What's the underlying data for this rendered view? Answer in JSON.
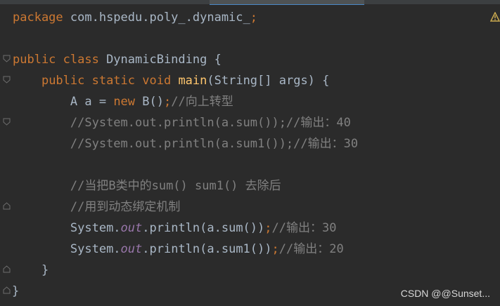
{
  "editor": {
    "lines": [
      {
        "parts": [
          "package",
          " com.hspedu.poly_.dynamic_",
          ";"
        ]
      },
      {
        "parts": [
          "public class",
          " DynamicBinding {"
        ]
      },
      {
        "parts": [
          "public static void",
          " ",
          "main",
          "(String[] args) {"
        ]
      },
      {
        "parts": [
          "A a = ",
          "new",
          " B()",
          ";",
          "//向上转型"
        ]
      },
      {
        "parts": [
          "//System.out.println(a.sum());//输出：40"
        ]
      },
      {
        "parts": [
          "//System.out.println(a.sum1());//输出：30"
        ]
      },
      {
        "parts": [
          "//当把B类中的sum() sum1() 去除后"
        ]
      },
      {
        "parts": [
          "//用到动态绑定机制"
        ]
      },
      {
        "parts": [
          "System.",
          "out",
          ".println(a.sum())",
          ";",
          "//输出：30"
        ]
      },
      {
        "parts": [
          "System.",
          "out",
          ".println(a.sum1())",
          ";",
          "//输出：20"
        ]
      },
      {
        "parts": [
          "}"
        ]
      },
      {
        "parts": [
          "}"
        ]
      }
    ]
  },
  "watermark": "CSDN @@Sunset...",
  "icons": {
    "warning": "warning-icon",
    "fold": "fold-marker-icon"
  },
  "colors": {
    "background": "#2b2b2b",
    "keyword": "#cc7832",
    "method": "#ffc66d",
    "comment": "#808080",
    "field": "#9876aa",
    "text": "#a9b7c6"
  }
}
